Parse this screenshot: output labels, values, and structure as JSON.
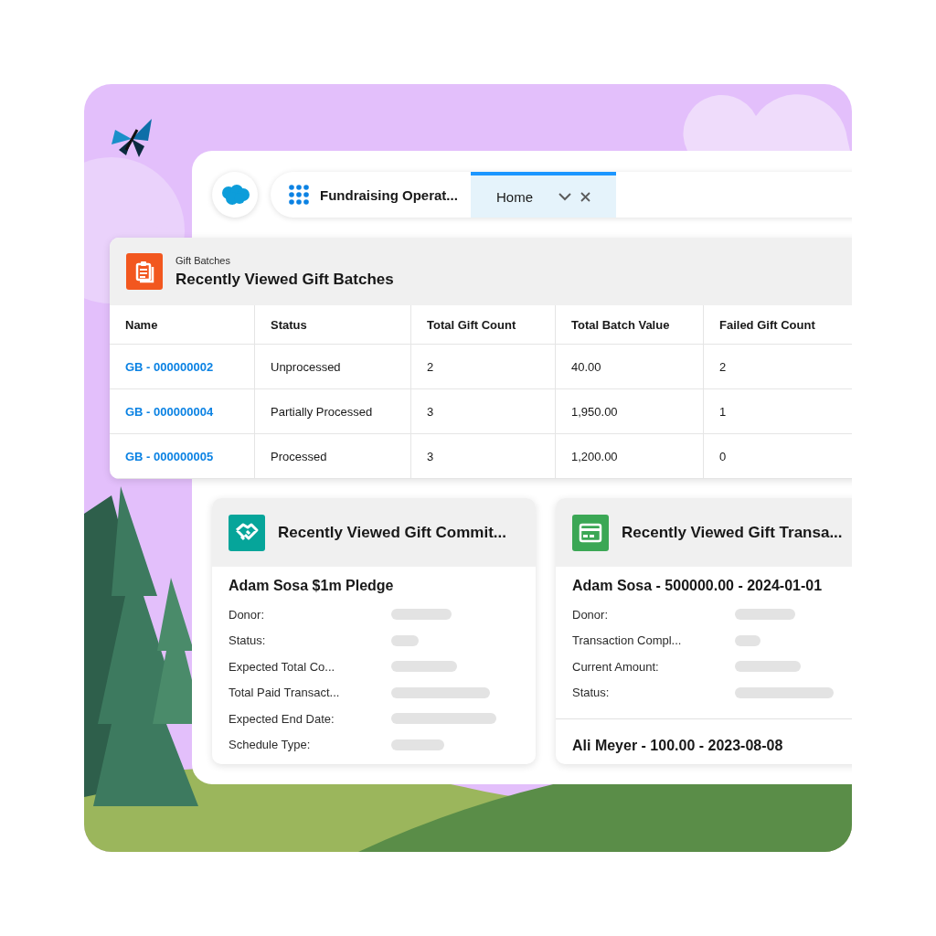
{
  "app_bar": {
    "app_name": "Fundraising Operat...",
    "tabs": [
      {
        "label": "Home",
        "selected": true
      }
    ]
  },
  "gift_batches": {
    "object_label": "Gift Batches",
    "title": "Recently Viewed Gift Batches",
    "columns": [
      "Name",
      "Status",
      "Total Gift Count",
      "Total Batch Value",
      "Failed Gift Count"
    ],
    "rows": [
      {
        "cells": [
          "GB - 000000002",
          "Unprocessed",
          "2",
          "40.00",
          "2"
        ]
      },
      {
        "cells": [
          "GB - 000000004",
          "Partially Processed",
          "3",
          "1,950.00",
          "1"
        ]
      },
      {
        "cells": [
          "GB - 000000005",
          "Processed",
          "3",
          "1,200.00",
          "0"
        ]
      }
    ]
  },
  "cards": [
    {
      "kind": "commitment",
      "title": "Recently Viewed Gift Commit...",
      "records": [
        {
          "title": "Adam Sosa $1m Pledge",
          "fields": [
            "Donor:",
            "Status:",
            "Expected Total Co...",
            "Total Paid Transact...",
            "Expected End Date:",
            "Schedule Type:"
          ]
        }
      ]
    },
    {
      "kind": "transaction",
      "title": "Recently Viewed Gift Transa...",
      "records": [
        {
          "title": "Adam Sosa - 500000.00 - 2024-01-01",
          "fields": [
            "Donor:",
            "Transaction Compl...",
            "Current Amount:",
            "Status:"
          ]
        },
        {
          "title": "Ali Meyer - 100.00 - 2023-08-08"
        }
      ]
    }
  ]
}
